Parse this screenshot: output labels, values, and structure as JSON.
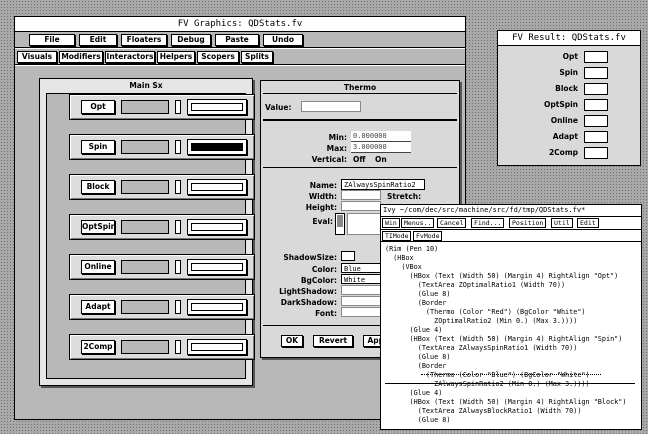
{
  "graphics_window": {
    "title": "FV Graphics: QDStats.fv",
    "menus": [
      "File",
      "Edit",
      "Floaters",
      "Debug",
      "Paste",
      "Undo"
    ],
    "tabs": [
      "Visuals",
      "Modifiers",
      "Interactors",
      "Helpers",
      "Scopers",
      "Splits"
    ],
    "canvas_title": "Main Sx",
    "rows": [
      {
        "label": "Opt",
        "fill": 0
      },
      {
        "label": "Spin",
        "fill": 1
      },
      {
        "label": "Block",
        "fill": 0
      },
      {
        "label": "OptSpin",
        "fill": 0
      },
      {
        "label": "Online",
        "fill": 0
      },
      {
        "label": "Adapt",
        "fill": 0
      },
      {
        "label": "2Comp",
        "fill": 0
      }
    ]
  },
  "inspector": {
    "title": "Thermo",
    "value_label": "Value:",
    "min_label": "Min:",
    "min_value": "0.000000",
    "max_label": "Max:",
    "max_value": "3.000000",
    "vertical_label": "Vertical:",
    "off_label": "Off",
    "on_label": "On",
    "name_label": "Name:",
    "name_value": "ZAlwaysSpinRatio2",
    "width_label": "Width:",
    "stretch_label": "Stretch:",
    "height_label": "Height:",
    "eval_label": "Eval:",
    "shadow_size_label": "ShadowSize:",
    "color_label": "Color:",
    "color_value": "Blue",
    "bgcolor_label": "BgColor:",
    "bgcolor_value": "White",
    "light_shadow_label": "LightShadow:",
    "dark_shadow_label": "DarkShadow:",
    "font_label": "Font:",
    "ok_label": "OK",
    "revert_label": "Revert",
    "apply_label": "Appl"
  },
  "result_window": {
    "title": "FV Result: QDStats.fv",
    "rows": [
      "Opt",
      "Spin",
      "Block",
      "OptSpin",
      "Online",
      "Adapt",
      "2Comp"
    ]
  },
  "code_window": {
    "title": "Ivy ~/com/dec/src/machine/src/fd/tmp/QDStats.fv*",
    "buttons_row1": [
      "Win",
      "Menus..",
      "Cancel",
      "Find...",
      "Position",
      "Util",
      "Edit"
    ],
    "buttons_row2": [
      "TIMode",
      "FvMode"
    ],
    "lines": [
      "(Rim (Pen 10)",
      "  (HBox",
      "    (VBox",
      "      (HBox (Text (Width 50) (Margin 4) RightAlign \"Opt\")",
      "        (TextArea ZOptimalRatio1 (Width 70))",
      "        (Glue 8)",
      "        (Border",
      "          (Thermo (Color \"Red\") (BgColor \"White\")",
      "            ZOptimalRatio2 (Min 0.) (Max 3.))))",
      "      (Glue 4)",
      "      (HBox (Text (Width 50) (Margin 4) RightAlign \"Spin\")",
      "        (TextArea ZAlwaysSpinRatio1 (Width 70))",
      "        (Glue 8)",
      "        (Border",
      "          (Thermo (Color \"Blue\") (BgColor \"White\")",
      "            ZAlwaysSpinRatio2 (Min 0.) (Max 3.))))",
      "      (Glue 4)",
      "      (HBox (Text (Width 50) (Margin 4) RightAlign \"Block\")",
      "        (TextArea ZAlwaysBlockRatio1 (Width 70))",
      "        (Glue 8)"
    ]
  }
}
